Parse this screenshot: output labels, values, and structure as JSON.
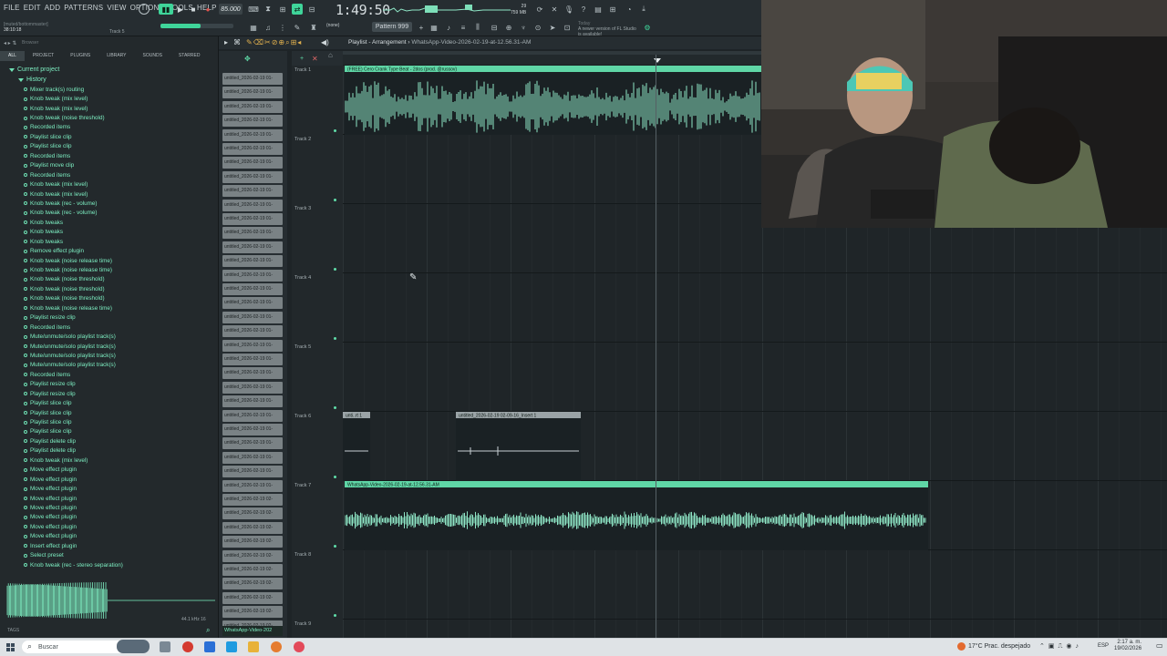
{
  "menu": [
    "FILE",
    "EDIT",
    "ADD",
    "PATTERNS",
    "VIEW",
    "OPTIONS",
    "TOOLS",
    "HELP"
  ],
  "hint": {
    "line1": "[muted/bottommaster]",
    "time": "38:10:18",
    "track": "Track 5"
  },
  "transport": {
    "tempo": "85.000",
    "time": "1:49:50",
    "pattern": "Pattern 999",
    "snap": "(none)"
  },
  "memory": {
    "cpu": "29",
    "mem": "759 MB",
    "voices": "0"
  },
  "update_note": {
    "today": "Today",
    "text": "A newer version of FL Studio is available!"
  },
  "browser": {
    "title": "Browser",
    "tabs": [
      "ALL",
      "PROJECT",
      "PLUGINS",
      "LIBRARY",
      "SOUNDS",
      "STARRED"
    ],
    "active_tab": 0,
    "root": "Current project",
    "history_label": "History",
    "history": [
      "Mixer track(s) routing",
      "Knob tweak (mix level)",
      "Knob tweak (mix level)",
      "Knob tweak (noise threshold)",
      "Recorded items",
      "Playlist slice clip",
      "Playlist slice clip",
      "Recorded items",
      "Playlist move clip",
      "Recorded items",
      "Knob tweak (mix level)",
      "Knob tweak (mix level)",
      "Knob tweak (rec - volume)",
      "Knob tweak (rec - volume)",
      "Knob tweaks",
      "Knob tweaks",
      "Knob tweaks",
      "Remove effect plugin",
      "Knob tweak (noise release time)",
      "Knob tweak (noise release time)",
      "Knob tweak (noise threshold)",
      "Knob tweak (noise threshold)",
      "Knob tweak (noise threshold)",
      "Knob tweak (noise release time)",
      "Playlist resize clip",
      "Recorded items",
      "Mute/unmute/solo playlist track(s)",
      "Mute/unmute/solo playlist track(s)",
      "Mute/unmute/solo playlist track(s)",
      "Mute/unmute/solo playlist track(s)",
      "Recorded items",
      "Playlist resize clip",
      "Playlist resize clip",
      "Playlist slice clip",
      "Playlist slice clip",
      "Playlist slice clip",
      "Playlist slice clip",
      "Playlist delete clip",
      "Playlist delete clip",
      "Knob tweak (mix level)",
      "Move effect plugin",
      "Move effect plugin",
      "Move effect plugin",
      "Move effect plugin",
      "Move effect plugin",
      "Move effect plugin",
      "Move effect plugin",
      "Move effect plugin",
      "Insert effect plugin",
      "Select preset",
      "Knob tweak (rec - stereo separation)"
    ],
    "sample_rate": "44.1 kHz 16",
    "tags": "TAGS"
  },
  "picker": {
    "items": [
      "untitled_2026-02-19 01-",
      "untitled_2026-02-19 01-",
      "untitled_2026-02-19 01-",
      "untitled_2026-02-19 01-",
      "untitled_2026-02-19 01-",
      "untitled_2026-02-19 01-",
      "untitled_2026-02-19 01-",
      "untitled_2026-02-19 01-",
      "untitled_2026-02-19 01-",
      "untitled_2026-02-19 01-",
      "untitled_2026-02-19 01-",
      "untitled_2026-02-19 01-",
      "untitled_2026-02-19 01-",
      "untitled_2026-02-19 01-",
      "untitled_2026-02-19 01-",
      "untitled_2026-02-19 01-",
      "untitled_2026-02-19 01-",
      "untitled_2026-02-19 01-",
      "untitled_2026-02-19 01-",
      "untitled_2026-02-19 01-",
      "untitled_2026-02-19 01-",
      "untitled_2026-02-19 01-",
      "untitled_2026-02-19 01-",
      "untitled_2026-02-19 01-",
      "untitled_2026-02-19 01-",
      "untitled_2026-02-19 01-",
      "untitled_2026-02-19 01-",
      "untitled_2026-02-19 01-",
      "untitled_2026-02-19 01-",
      "untitled_2026-02-19 01-",
      "untitled_2026-02-19 02-",
      "untitled_2026-02-19 02-",
      "untitled_2026-02-19 02-",
      "untitled_2026-02-19 02-",
      "untitled_2026-02-19 02-",
      "untitled_2026-02-19 02-",
      "untitled_2026-02-19 02-",
      "untitled_2026-02-19 02-",
      "untitled_2026-02-19 02-",
      "untitled_2026-02-19 02-"
    ],
    "selected": "WhatsApp-Video-202"
  },
  "playlist": {
    "title_prefix": "Playlist - Arrangement",
    "title_file": "WhatsApp-Video-2026-02-19-at-12.56.31-AM",
    "tracks": [
      "Track 1",
      "Track 2",
      "Track 3",
      "Track 4",
      "Track 5",
      "Track 6",
      "Track 7",
      "Track 8",
      "Track 9"
    ],
    "clips": {
      "track1": "(FREE) Cero  Crank Type Beat - 2dos (prod. @russov)",
      "track6a": "unti..rt 1",
      "track6b": "untitled_2026-02-19 02-09-16_Insert 1",
      "track7": "WhatsApp-Video-2026-02-19-at-12.56.31-AM"
    },
    "colors": {
      "clip_green": "#5fd6a6",
      "clip_gray": "#9aa3a6",
      "wave": "#8fe6c6"
    }
  },
  "taskbar": {
    "search_placeholder": "Buscar",
    "weather": "17°C  Prac. despejado",
    "lang": "ESP",
    "time": "2:17 a. m.",
    "date": "19/02/2026"
  }
}
